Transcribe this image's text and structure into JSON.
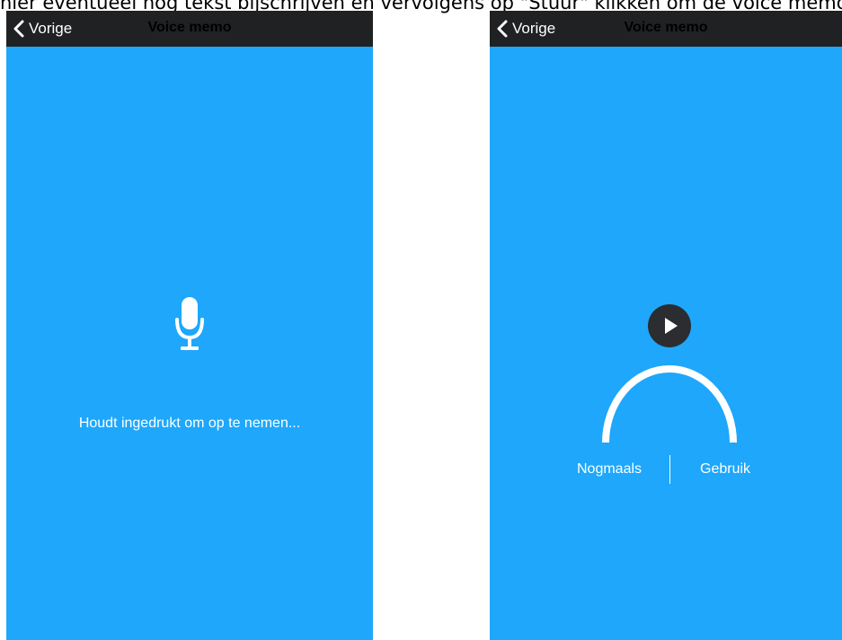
{
  "caption": "hier eventueel nog tekst bijschrijven en vervolgens op \"Stuur\" klikken om de voice memo te versturen.",
  "screens": [
    {
      "nav": {
        "back_label": "Vorige",
        "title": "Voice memo"
      },
      "icon": "microphone-icon",
      "hint": "Houdt ingedrukt om op te nemen..."
    },
    {
      "nav": {
        "back_label": "Vorige",
        "title": "Voice memo"
      },
      "icon": "play-icon",
      "actions": {
        "again": "Nogmaals",
        "use": "Gebruik"
      }
    }
  ],
  "colors": {
    "background": "#1ea7fb",
    "navbar": "#1f2123",
    "play_button": "#2b2d30"
  }
}
